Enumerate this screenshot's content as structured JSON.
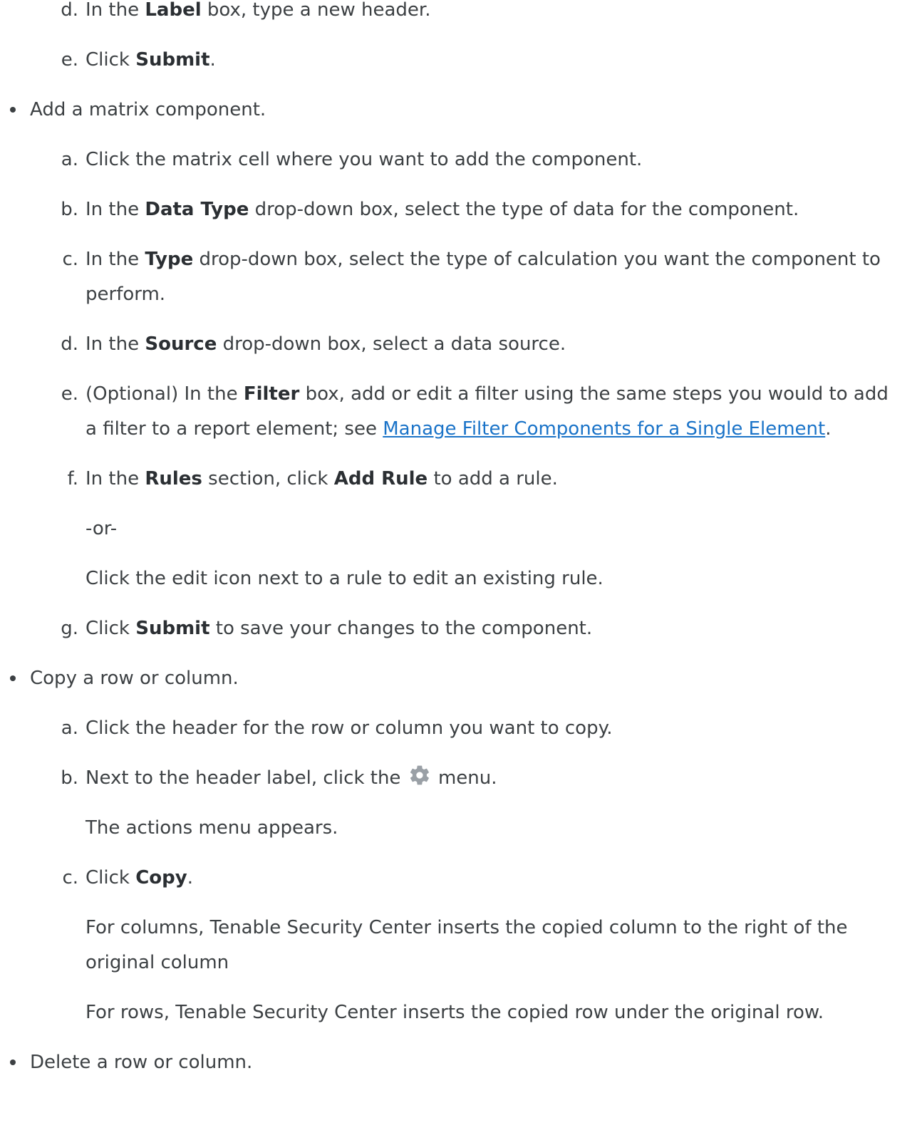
{
  "top_steps": [
    {
      "marker": "d.",
      "t1": "In the ",
      "b1": "Label",
      "t2": " box, type a new header."
    },
    {
      "marker": "e.",
      "t1": "Click ",
      "b1": "Submit",
      "t2": "."
    }
  ],
  "add_component": {
    "bullet": "Add a matrix component.",
    "steps": {
      "a": {
        "marker": "a.",
        "text": "Click the matrix cell where you want to add the component."
      },
      "b": {
        "marker": "b.",
        "t1": "In the ",
        "b1": "Data Type",
        "t2": " drop-down box, select the type of data for the component."
      },
      "c": {
        "marker": "c.",
        "t1": "In the ",
        "b1": "Type",
        "t2": " drop-down box, select the type of calculation you want the component to perform."
      },
      "d": {
        "marker": "d.",
        "t1": "In the ",
        "b1": "Source",
        "t2": " drop-down box, select a data source."
      },
      "e": {
        "marker": "e.",
        "t1": "(Optional) In the ",
        "b1": "Filter",
        "t2": " box, add or edit a filter using the same steps you would to add a filter to a report element; see ",
        "link": "Manage Filter Components for a Single Element",
        "t3": "."
      },
      "f": {
        "marker": "f.",
        "t1": "In the ",
        "b1": "Rules",
        "t2": " section, click ",
        "b2": "Add Rule",
        "t3": " to add a rule.",
        "or": "-or-",
        "p2": "Click the edit icon next to a rule to edit an existing rule."
      },
      "g": {
        "marker": "g.",
        "t1": "Click ",
        "b1": "Submit",
        "t2": " to save your changes to the component."
      }
    }
  },
  "copy_row": {
    "bullet": "Copy a row or column.",
    "steps": {
      "a": {
        "marker": "a.",
        "text": "Click the header for the row or column you want to copy."
      },
      "b": {
        "marker": "b.",
        "t1": "Next to the header label, click the ",
        "icon": "gear-icon",
        "t2": " menu.",
        "p2": "The actions menu appears."
      },
      "c": {
        "marker": "c.",
        "t1": "Click ",
        "b1": "Copy",
        "t2": ".",
        "p2": "For columns, Tenable Security Center inserts the copied column to the right of the original column",
        "p3": "For rows, Tenable Security Center inserts the copied row under the original row."
      }
    }
  },
  "delete_row": {
    "bullet": "Delete a row or column."
  },
  "colors": {
    "text": "#3c4043",
    "link": "#1a73c8",
    "icon": "#9aa0a6"
  }
}
